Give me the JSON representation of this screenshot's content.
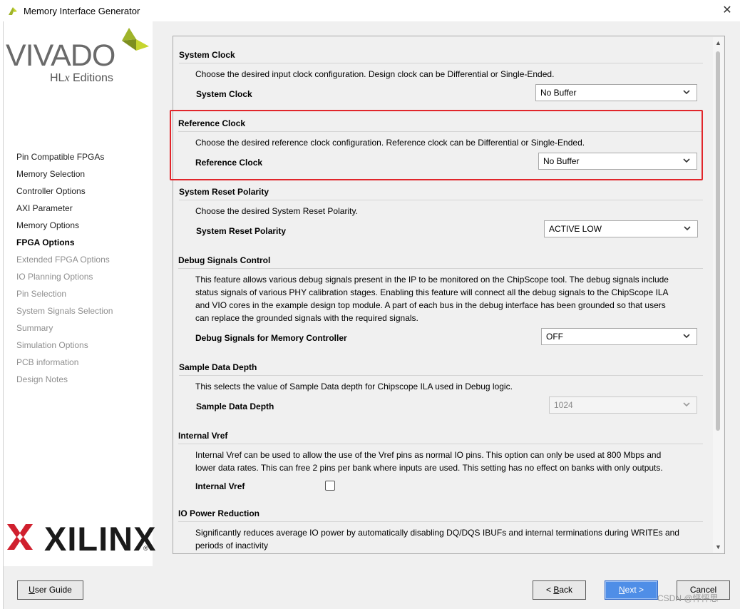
{
  "window": {
    "title": "Memory Interface Generator"
  },
  "branding": {
    "product": "VIVADO",
    "edition_prefix": "HL",
    "edition_x": "x",
    "edition_suffix": " Editions",
    "vendor": "XILINX",
    "reg_mark": "®",
    "leaf_colors": [
      "#c6d52f",
      "#9fb42a",
      "#7d8f1f"
    ],
    "xilinx_red": "#d0202e"
  },
  "nav": [
    {
      "label": "Pin Compatible FPGAs",
      "state": "normal"
    },
    {
      "label": "Memory Selection",
      "state": "normal"
    },
    {
      "label": "Controller Options",
      "state": "normal"
    },
    {
      "label": "AXI Parameter",
      "state": "normal"
    },
    {
      "label": "Memory Options",
      "state": "normal"
    },
    {
      "label": "FPGA Options",
      "state": "active"
    },
    {
      "label": "Extended FPGA Options",
      "state": "disabled"
    },
    {
      "label": "IO Planning Options",
      "state": "disabled"
    },
    {
      "label": "Pin Selection",
      "state": "disabled"
    },
    {
      "label": "System Signals Selection",
      "state": "disabled"
    },
    {
      "label": "Summary",
      "state": "disabled"
    },
    {
      "label": "Simulation Options",
      "state": "disabled"
    },
    {
      "label": "PCB information",
      "state": "disabled"
    },
    {
      "label": "Design Notes",
      "state": "disabled"
    }
  ],
  "sections": {
    "system_clock": {
      "heading": "System Clock",
      "desc": "Choose the desired input clock configuration. Design clock can be Differential or Single-Ended.",
      "label": "System Clock",
      "value": "No Buffer"
    },
    "reference_clock": {
      "heading": "Reference Clock",
      "desc": "Choose the desired reference clock configuration. Reference clock can be Differential or Single-Ended.",
      "label": "Reference Clock",
      "value": "No Buffer"
    },
    "reset_polarity": {
      "heading": "System Reset Polarity",
      "desc": "Choose the desired System Reset Polarity.",
      "label": "System Reset Polarity",
      "value": "ACTIVE LOW"
    },
    "debug": {
      "heading": "Debug Signals Control",
      "desc_lines": [
        "This feature allows various debug signals present in the IP to be monitored on the ChipScope tool. The debug signals include",
        "status signals of various PHY calibration stages. Enabling this feature will connect all the debug signals to the ChipScope ILA",
        "and VIO cores in the example design top module. A part of each bus in the debug interface has been grounded so that users",
        "can replace the grounded signals with the required signals."
      ],
      "label": "Debug Signals for Memory Controller",
      "value": "OFF"
    },
    "sample_depth": {
      "heading": "Sample Data Depth",
      "desc": "This selects the value of Sample Data depth for Chipscope ILA used in Debug logic.",
      "label": "Sample Data Depth",
      "value": "1024"
    },
    "vref": {
      "heading": "Internal Vref",
      "desc_lines": [
        "Internal Vref can be used to allow the use of the Vref pins as normal IO pins. This option can only be used at 800 Mbps and",
        "lower data rates. This can free 2 pins per bank where inputs are used. This setting has no effect on banks with only outputs."
      ],
      "label": "Internal Vref",
      "checked": false
    },
    "io_power": {
      "heading": "IO Power Reduction",
      "desc_lines": [
        "Significantly reduces average IO power by automatically disabling DQ/DQS IBUFs and internal terminations during WRITEs and",
        "periods of inactivity"
      ]
    }
  },
  "buttons": {
    "user_guide_u": "U",
    "user_guide_rest": "ser Guide",
    "back_pre": "< ",
    "back_u": "B",
    "back_rest": "ack",
    "next_u": "N",
    "next_rest": "ext >",
    "cancel": "Cancel"
  },
  "watermark": "CSDN @怦怦思",
  "colors": {
    "highlight_box": "#e1262b",
    "next_button": "#4f8ee7"
  }
}
